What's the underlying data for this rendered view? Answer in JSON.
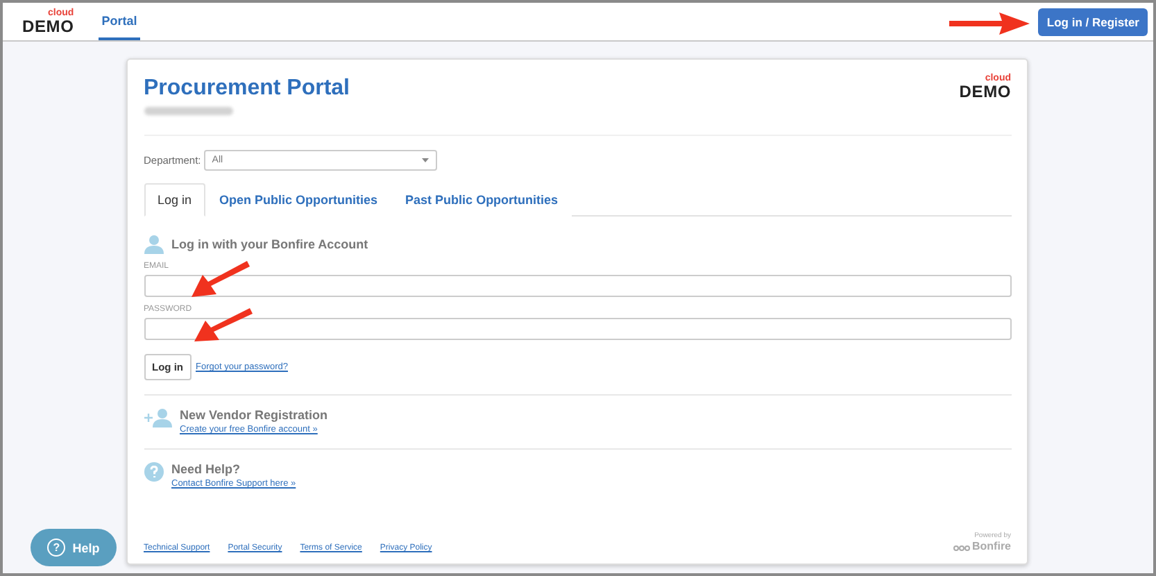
{
  "header": {
    "logo": {
      "top": "cloud",
      "bottom": "DEMO"
    },
    "nav": [
      {
        "label": "Portal",
        "selected": true
      }
    ],
    "action": "Log in / Register"
  },
  "card": {
    "title": "Procurement Portal",
    "logo": {
      "top": "cloud",
      "bottom": "DEMO"
    },
    "department": {
      "label": "Department:",
      "value": "All"
    },
    "tabs": [
      {
        "label": "Log in",
        "selected": true
      },
      {
        "label": "Open Public Opportunities",
        "selected": false
      },
      {
        "label": "Past Public Opportunities",
        "selected": false
      }
    ],
    "login": {
      "heading": "Log in with your Bonfire Account",
      "fields": [
        {
          "label": "EMAIL"
        },
        {
          "label": "PASSWORD"
        }
      ],
      "button": "Log in",
      "forgot": "Forgot your password?"
    },
    "sections": [
      {
        "kind": "register",
        "heading": "New Vendor Registration",
        "link": "Create your free Bonfire account »"
      },
      {
        "kind": "help",
        "heading": "Need Help?",
        "link": "Contact Bonfire Support here »"
      }
    ],
    "footer_links": [
      "Technical Support",
      "Portal Security",
      "Terms of Service",
      "Privacy Policy"
    ],
    "powered": {
      "caption": "Powered by",
      "brand": "Bonfire"
    }
  },
  "help_button": {
    "icon": "?",
    "label": "Help"
  }
}
